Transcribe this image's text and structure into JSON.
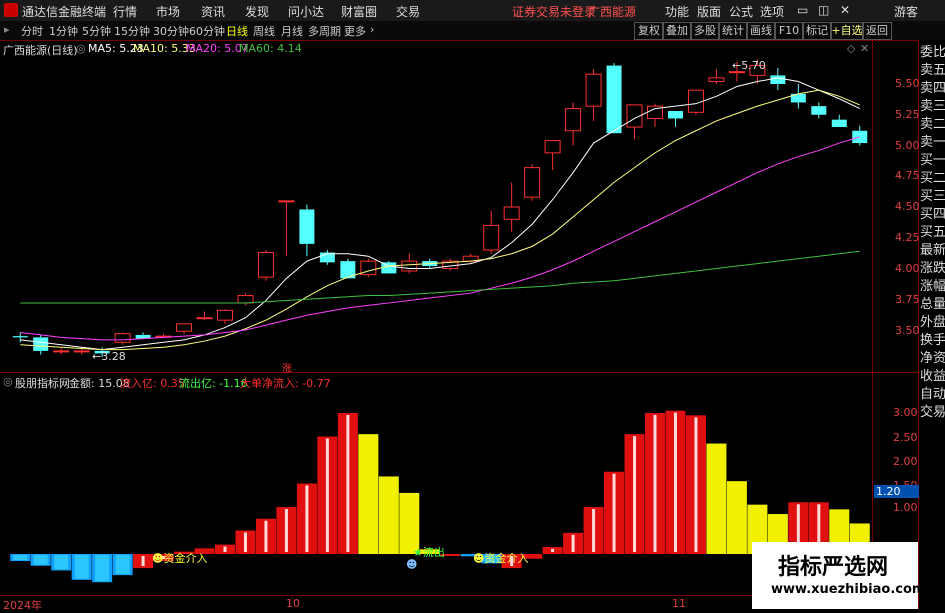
{
  "app": {
    "title": "通达信金融终端",
    "menu": [
      "行情",
      "市场",
      "资讯",
      "发现",
      "问小达",
      "财富圈",
      "交易"
    ],
    "login_warning": "证券交易未登录",
    "stock_name": "广西能源",
    "right_menu": [
      "功能",
      "版面",
      "公式",
      "选项"
    ],
    "guest": "游客"
  },
  "toolbar": {
    "periods": [
      "分时",
      "1分钟",
      "5分钟",
      "15分钟",
      "30分钟",
      "60分钟",
      "日线",
      "周线",
      "月线",
      "多周期",
      "更多"
    ],
    "active": "日线",
    "right_buttons": [
      "复权",
      "叠加",
      "多股",
      "统计",
      "画线",
      "F10",
      "标记",
      "+自选",
      "返回"
    ]
  },
  "side_panel": {
    "items": [
      "委比",
      "卖五",
      "卖四",
      "卖三",
      "卖二",
      "卖一",
      "买一",
      "买二",
      "买三",
      "买四",
      "买五",
      "最新",
      "涨跌",
      "涨幅",
      "总量",
      "外盘",
      "换手",
      "净资",
      "收益"
    ],
    "items2": [
      "自动",
      "交易"
    ]
  },
  "main_legend": {
    "name": "广西能源(日线)",
    "ma5_label": "MA5: 5.23",
    "ma10_label": "MA10: 5.33",
    "ma20_label": "MA20: 5.07",
    "ma60_label": "MA60: 4.14",
    "colors": {
      "ma5": "#ffffff",
      "ma10": "#ffff80",
      "ma20": "#ff40ff",
      "ma60": "#40c040"
    }
  },
  "annotations": {
    "high": "5.70",
    "low": "3.28",
    "zhang": "涨"
  },
  "main_yticks": [
    "5.50",
    "5.25",
    "5.00",
    "4.75",
    "4.50",
    "4.25",
    "4.00",
    "3.75",
    "3.50"
  ],
  "sub_legend": {
    "name": "股朋指标网",
    "amount": "金额: 15.08",
    "inflow": "流入亿: 0.35",
    "outflow": "流出亿: -1.16",
    "net": "大单净流入: -0.77"
  },
  "sub_yticks": [
    "3.00",
    "2.50",
    "2.00",
    "1.50",
    "1.00"
  ],
  "sub_current": "1.20",
  "sub_signals": {
    "in1": "资金介入",
    "out": "流出",
    "in2": "资金介入"
  },
  "xaxis": [
    "2024年",
    "10",
    "11"
  ],
  "watermark": {
    "name": "指标严选网",
    "url": "www.xuezhibiao.com"
  },
  "chart_data": [
    {
      "type": "candlestick",
      "title": "广西能源(日线)",
      "ylim": [
        3.3,
        5.8
      ],
      "ohlc": [
        [
          3.45,
          3.48,
          3.4,
          3.44
        ],
        [
          3.44,
          3.46,
          3.3,
          3.33
        ],
        [
          3.33,
          3.36,
          3.3,
          3.33
        ],
        [
          3.33,
          3.36,
          3.3,
          3.33
        ],
        [
          3.33,
          3.36,
          3.28,
          3.31
        ],
        [
          3.4,
          3.48,
          3.38,
          3.47
        ],
        [
          3.46,
          3.48,
          3.43,
          3.43
        ],
        [
          3.45,
          3.47,
          3.44,
          3.45
        ],
        [
          3.49,
          3.55,
          3.47,
          3.55
        ],
        [
          3.6,
          3.65,
          3.58,
          3.6
        ],
        [
          3.58,
          3.67,
          3.55,
          3.66
        ],
        [
          3.72,
          3.8,
          3.7,
          3.78
        ],
        [
          3.93,
          4.15,
          3.9,
          4.13
        ],
        [
          4.55,
          4.55,
          4.1,
          4.55
        ],
        [
          4.48,
          4.52,
          4.1,
          4.2
        ],
        [
          4.13,
          4.15,
          4.03,
          4.05
        ],
        [
          4.06,
          4.08,
          3.92,
          3.92
        ],
        [
          3.95,
          4.08,
          3.93,
          4.06
        ],
        [
          4.05,
          4.06,
          3.96,
          3.96
        ],
        [
          3.98,
          4.12,
          3.96,
          4.06
        ],
        [
          4.06,
          4.08,
          4.0,
          4.02
        ],
        [
          4.0,
          4.08,
          3.98,
          4.06
        ],
        [
          4.06,
          4.12,
          4.04,
          4.1
        ],
        [
          4.15,
          4.47,
          4.12,
          4.35
        ],
        [
          4.4,
          4.7,
          4.3,
          4.5
        ],
        [
          4.58,
          4.85,
          4.55,
          4.82
        ],
        [
          4.94,
          5.02,
          4.8,
          5.04
        ],
        [
          5.12,
          5.35,
          5.0,
          5.3
        ],
        [
          5.32,
          5.62,
          5.2,
          5.58
        ],
        [
          5.65,
          5.67,
          5.1,
          5.1
        ],
        [
          5.15,
          5.33,
          5.05,
          5.33
        ],
        [
          5.22,
          5.34,
          5.15,
          5.32
        ],
        [
          5.28,
          5.28,
          5.15,
          5.22
        ],
        [
          5.27,
          5.45,
          5.25,
          5.45
        ],
        [
          5.52,
          5.62,
          5.5,
          5.55
        ],
        [
          5.6,
          5.68,
          5.52,
          5.6
        ],
        [
          5.57,
          5.7,
          5.5,
          5.65
        ],
        [
          5.57,
          5.63,
          5.45,
          5.5
        ],
        [
          5.42,
          5.5,
          5.3,
          5.35
        ],
        [
          5.32,
          5.35,
          5.22,
          5.25
        ],
        [
          5.21,
          5.25,
          5.15,
          5.15
        ],
        [
          5.12,
          5.16,
          5.0,
          5.02
        ]
      ],
      "series": [
        {
          "name": "MA5",
          "values": [
            3.42,
            3.4,
            3.38,
            3.36,
            3.34,
            3.36,
            3.38,
            3.4,
            3.42,
            3.46,
            3.52,
            3.6,
            3.74,
            3.92,
            4.06,
            4.12,
            4.12,
            4.1,
            4.02,
            4.0,
            4.0,
            4.02,
            4.04,
            4.09,
            4.21,
            4.36,
            4.56,
            4.78,
            5.02,
            5.12,
            5.22,
            5.3,
            5.32,
            5.34,
            5.4,
            5.48,
            5.52,
            5.55,
            5.52,
            5.45,
            5.38,
            5.3
          ]
        },
        {
          "name": "MA10",
          "values": [
            3.38,
            3.37,
            3.36,
            3.35,
            3.34,
            3.34,
            3.35,
            3.36,
            3.38,
            3.41,
            3.45,
            3.51,
            3.58,
            3.67,
            3.77,
            3.86,
            3.93,
            3.98,
            4.02,
            4.03,
            4.04,
            4.05,
            4.06,
            4.08,
            4.12,
            4.18,
            4.28,
            4.42,
            4.56,
            4.7,
            4.82,
            4.94,
            5.04,
            5.12,
            5.2,
            5.26,
            5.32,
            5.37,
            5.42,
            5.45,
            5.4,
            5.33
          ]
        },
        {
          "name": "MA20",
          "values": [
            3.48,
            3.46,
            3.44,
            3.43,
            3.42,
            3.42,
            3.43,
            3.44,
            3.45,
            3.46,
            3.48,
            3.5,
            3.54,
            3.58,
            3.62,
            3.65,
            3.68,
            3.7,
            3.72,
            3.74,
            3.76,
            3.78,
            3.8,
            3.84,
            3.88,
            3.93,
            3.99,
            4.06,
            4.14,
            4.22,
            4.3,
            4.38,
            4.46,
            4.54,
            4.62,
            4.7,
            4.78,
            4.85,
            4.91,
            4.96,
            5.02,
            5.07
          ]
        },
        {
          "name": "MA60",
          "values": [
            3.72,
            3.72,
            3.72,
            3.72,
            3.72,
            3.72,
            3.72,
            3.72,
            3.72,
            3.72,
            3.72,
            3.72,
            3.73,
            3.74,
            3.75,
            3.76,
            3.77,
            3.78,
            3.78,
            3.79,
            3.8,
            3.81,
            3.82,
            3.83,
            3.84,
            3.85,
            3.86,
            3.88,
            3.89,
            3.9,
            3.92,
            3.94,
            3.96,
            3.98,
            4.0,
            4.02,
            4.04,
            4.06,
            4.08,
            4.1,
            4.12,
            4.14
          ]
        }
      ]
    },
    {
      "type": "bar",
      "title": "股朋指标网",
      "ylim": [
        -0.7,
        3.4
      ],
      "values": [
        -0.15,
        -0.25,
        -0.35,
        -0.55,
        -0.6,
        -0.45,
        -0.3,
        -0.15,
        0.05,
        0.12,
        0.2,
        0.5,
        0.75,
        1.0,
        1.5,
        2.5,
        3.0,
        2.55,
        1.65,
        1.3,
        0.1,
        0,
        -0.05,
        -0.2,
        -0.3,
        -0.1,
        0.15,
        0.45,
        1.0,
        1.75,
        2.55,
        3.0,
        3.05,
        2.95,
        2.35,
        1.55,
        1.05,
        0.85,
        1.1,
        1.1,
        0.95,
        0.65
      ],
      "kinds": [
        "cyan",
        "cyan",
        "cyan",
        "cyan",
        "cyan",
        "cyan",
        "red",
        "red",
        "red",
        "red",
        "red",
        "red",
        "red",
        "red",
        "red",
        "red",
        "red",
        "yellow",
        "yellow",
        "yellow",
        "yellow",
        "red",
        "cyan",
        "cyan",
        "red",
        "red",
        "red",
        "red",
        "red",
        "red",
        "red",
        "red",
        "red",
        "red",
        "yellow",
        "yellow",
        "yellow",
        "yellow",
        "red",
        "red",
        "yellow",
        "yellow"
      ]
    }
  ]
}
